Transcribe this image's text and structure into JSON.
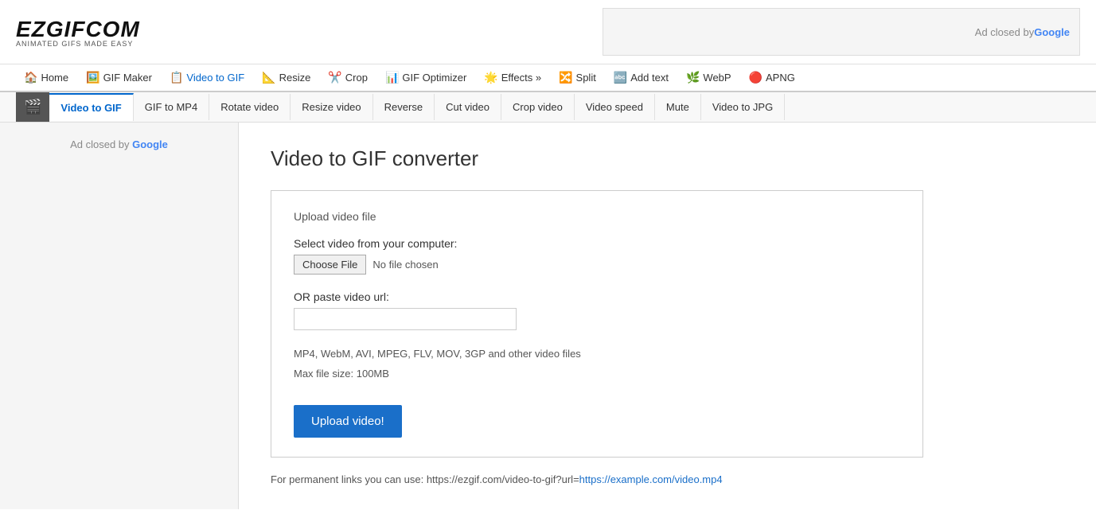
{
  "logo": {
    "text": "EZGIFCOM",
    "tagline": "ANIMATED GIFS MADE EASY"
  },
  "ad_top": {
    "label": "Ad closed by ",
    "google": "Google"
  },
  "main_nav": [
    {
      "id": "home",
      "icon": "🏠",
      "label": "Home"
    },
    {
      "id": "gif-maker",
      "icon": "🖼️",
      "label": "GIF Maker"
    },
    {
      "id": "video-to-gif",
      "icon": "📋",
      "label": "Video to GIF",
      "active": true
    },
    {
      "id": "resize",
      "icon": "📐",
      "label": "Resize"
    },
    {
      "id": "crop",
      "icon": "✂️",
      "label": "Crop"
    },
    {
      "id": "gif-optimizer",
      "icon": "📊",
      "label": "GIF Optimizer"
    },
    {
      "id": "effects",
      "icon": "🌟",
      "label": "Effects »"
    },
    {
      "id": "split",
      "icon": "🔀",
      "label": "Split"
    },
    {
      "id": "add-text",
      "icon": "🔤",
      "label": "Add text"
    },
    {
      "id": "webp",
      "icon": "🌿",
      "label": "WebP"
    },
    {
      "id": "apng",
      "icon": "🔴",
      "label": "APNG"
    }
  ],
  "sub_nav": [
    {
      "id": "video-to-gif",
      "label": "Video to GIF",
      "active": true
    },
    {
      "id": "gif-to-mp4",
      "label": "GIF to MP4"
    },
    {
      "id": "rotate-video",
      "label": "Rotate video"
    },
    {
      "id": "resize-video",
      "label": "Resize video"
    },
    {
      "id": "reverse",
      "label": "Reverse"
    },
    {
      "id": "cut-video",
      "label": "Cut video"
    },
    {
      "id": "crop-video",
      "label": "Crop video"
    },
    {
      "id": "video-speed",
      "label": "Video speed"
    },
    {
      "id": "mute",
      "label": "Mute"
    },
    {
      "id": "video-to-jpg",
      "label": "Video to JPG"
    }
  ],
  "sidebar": {
    "ad_label": "Ad closed by ",
    "google": "Google"
  },
  "main": {
    "page_title": "Video to GIF converter",
    "upload_section_title": "Upload video file",
    "select_label": "Select video from your computer:",
    "choose_file_label": "Choose File",
    "no_file_text": "No file chosen",
    "or_paste_label": "OR paste video url:",
    "url_placeholder": "",
    "file_formats": "MP4, WebM, AVI, MPEG, FLV, MOV, 3GP and other video files",
    "max_size": "Max file size: 100MB",
    "upload_button": "Upload video!",
    "footer_note_static": "For permanent links you can use: https://ezgif.com/video-to-gif?url=",
    "footer_note_link_text": "https://example.com/video.mp4",
    "footer_note_link_href": "https://example.com/video.mp4"
  }
}
